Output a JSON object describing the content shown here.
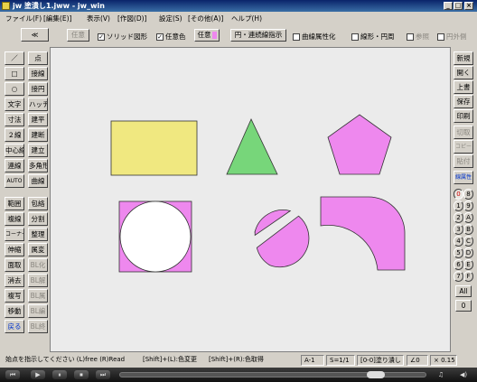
{
  "window": {
    "title": "jw 塗潰し1.jww - jw_win",
    "controls": [
      "_",
      "□",
      "×"
    ]
  },
  "menu": [
    "ファイル(F)",
    "[編集(E)]",
    "表示(V)",
    "[作図(D)]",
    "設定(S)",
    "[その他(A)]",
    "ヘルプ(H)"
  ],
  "toolbar": {
    "collapse": "≪",
    "dimmed_button": "任意",
    "solid_check": "ソリッド図形",
    "color_check": "任意色",
    "color_button": "任意",
    "arc_button": "円・連続線指示",
    "curve_check": "曲線属性化",
    "line_check": "線形・円周",
    "dim_check1": "参照",
    "dim_check2": "円外側"
  },
  "left_tools": [
    [
      "／",
      "点"
    ],
    [
      "□",
      "接線"
    ],
    [
      "○",
      "接円"
    ],
    [
      "文字",
      "ハッチ"
    ],
    [
      "寸法",
      "建平"
    ],
    [
      "２線",
      "建断"
    ],
    [
      "中心線",
      "建立"
    ],
    [
      "連線",
      "多角形"
    ],
    [
      "AUTO",
      "曲線"
    ],
    [
      "範囲",
      "包絡"
    ],
    [
      "複線",
      "分割"
    ],
    [
      "コーナー",
      "整理"
    ],
    [
      "伸縮",
      "属変"
    ],
    [
      "面取",
      "BL化"
    ],
    [
      "消去",
      "BL解"
    ],
    [
      "複写",
      "BL属"
    ],
    [
      "移動",
      "BL編"
    ],
    [
      "戻る",
      "BL終"
    ]
  ],
  "right_tools": [
    "新規",
    "開く",
    "上書",
    "保存",
    "印刷",
    "切取",
    "コピー",
    "貼付",
    "線属性"
  ],
  "layer_groups": [
    "0",
    "8",
    "1",
    "9",
    "2",
    "A",
    "3",
    "B",
    "4",
    "C",
    "5",
    "D",
    "6",
    "E",
    "7",
    "F"
  ],
  "layer_all": "All",
  "layer_current": "0",
  "status": {
    "hint": "始点を指示してください (L)free (R)Read",
    "shift_l": "[Shift]+(L):色変更",
    "shift_r": "[Shift]+(R):色取得",
    "paper": "A-1",
    "scale": "S=1/1",
    "layer": "[0-0]塗り潰し",
    "angle": "∠0",
    "zoom": "× 0.15"
  },
  "player": {
    "buttons": [
      "⏮",
      "▶",
      "⏸",
      "⏹",
      "⏭"
    ],
    "progress": 0.86
  },
  "colors": {
    "yellow": "#f0e880",
    "green": "#77d67a",
    "pink": "#ee88ee",
    "white": "#ffffff",
    "canvas": "#ebebeb"
  }
}
